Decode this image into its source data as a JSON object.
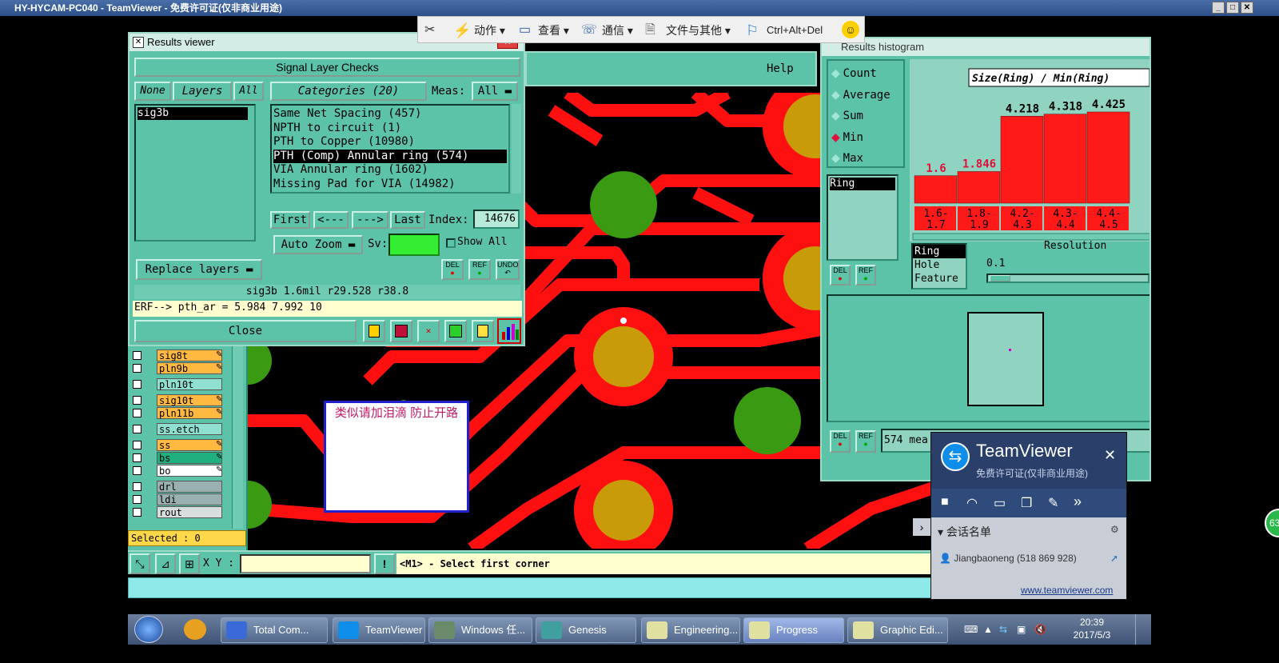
{
  "window": {
    "title": "HY-HYCAM-PC040 - TeamViewer - 免费许可证(仅非商业用途)"
  },
  "teamviewer_toolbar": {
    "actions": "动作",
    "view": "查看",
    "communicate": "通信",
    "files": "文件与其他",
    "cad": "Ctrl+Alt+Del"
  },
  "results_viewer": {
    "title": "Results viewer",
    "header": "Signal Layer Checks",
    "none_btn": "None",
    "layers_btn": "Layers",
    "all_btn": "All",
    "layer_items": [
      "sig3b"
    ],
    "categories_btn": "Categories (20)",
    "meas_label": "Meas:",
    "meas_value": "All",
    "categories": [
      "Same Net Spacing (457)",
      "NPTH to circuit (1)",
      "PTH to Copper (10980)",
      "PTH (Comp) Annular ring (574)",
      "VIA Annular ring (1602)",
      "Missing Pad for VIA (14982)"
    ],
    "first": "First",
    "prev": "<---",
    "next": "--->",
    "last": "Last",
    "index_label": "Index:",
    "index_value": "14676",
    "auto_zoom": "Auto Zoom",
    "sv_label": "Sv:",
    "show_all": "Show All",
    "replace_layers": "Replace layers",
    "del": "DEL",
    "ref": "REF",
    "undo": "UNDO",
    "status": "sig3b 1.6mil   r29.528  r38.8",
    "erf": "ERF--> pth_ar = 5.984 7.992 10",
    "close": "Close"
  },
  "results_histogram": {
    "title": "Results histogram",
    "help": "Help",
    "options": [
      "Count",
      "Average",
      "Sum",
      "Min",
      "Max"
    ],
    "selected_option": "Min",
    "chart_title": "Size(Ring) / Min(Ring)",
    "list_items": [
      "Ring"
    ],
    "type_items": [
      "Ring",
      "Hole",
      "Feature"
    ],
    "resolution_label": "Resolution",
    "resolution_value": "0.1",
    "del": "DEL",
    "ref": "REF",
    "measures_text": "574 mea",
    "bar_color": "#ff1a1a"
  },
  "chart_data": {
    "type": "bar",
    "title": "Size(Ring) / Min(Ring)",
    "categories": [
      "1.6-\n1.7",
      "1.8-\n1.9",
      "4.2-\n4.3",
      "4.3-\n4.4",
      "4.4-\n4.5"
    ],
    "category_labels": [
      [
        "1.6-",
        "1.7"
      ],
      [
        "1.8-",
        "1.9"
      ],
      [
        "4.2-",
        "4.3"
      ],
      [
        "4.3-",
        "4.4"
      ],
      [
        "4.4-",
        "4.5"
      ]
    ],
    "values": [
      1.6,
      1.846,
      4.218,
      4.318,
      4.425
    ],
    "value_labels": [
      "1.6",
      "1.846",
      "4.218",
      "4.318",
      "4.425"
    ],
    "ylim": [
      0,
      4.6
    ]
  },
  "layers_panel": {
    "layers": [
      {
        "name": "sig8t",
        "style": "orange",
        "marked": true
      },
      {
        "name": "pln9b",
        "style": "orange",
        "marked": true
      },
      {
        "name": "pln10t",
        "style": "teal",
        "marked": false
      },
      {
        "name": "sig10t",
        "style": "orange",
        "marked": true
      },
      {
        "name": "pln11b",
        "style": "orange",
        "marked": true
      },
      {
        "name": "ss.etch",
        "style": "teal",
        "marked": false
      },
      {
        "name": "ss",
        "style": "orange",
        "marked": true
      },
      {
        "name": "bs",
        "style": "green",
        "marked": true
      },
      {
        "name": "bo",
        "style": "white",
        "marked": true
      },
      {
        "name": "drl",
        "style": "gray",
        "marked": false
      },
      {
        "name": "ldi",
        "style": "gray",
        "marked": false
      },
      {
        "name": "rout",
        "style": "light",
        "marked": false
      }
    ],
    "selected": "Selected : 0"
  },
  "annotation_note": "类似请加泪滴  防止开路",
  "bottom_bar": {
    "xy_label": "X Y :",
    "xy_value": "",
    "prompt": "<M1> - Select first corner"
  },
  "tv_popup": {
    "brand": "TeamViewer",
    "license": "免费许可证(仅非商业用途)",
    "session_list": "会话名单",
    "contact": "Jiangbaoneng (518 869 928)",
    "link": "www.teamviewer.com"
  },
  "taskbar": {
    "apps": [
      "Total Com...",
      "TeamViewer",
      "Windows 任...",
      "Genesis",
      "Engineering...",
      "Progress",
      "Graphic Edi..."
    ],
    "time": "20:39",
    "date": "2017/5/3"
  },
  "side_badge": "63",
  "colors": {
    "teal": "#5dc3a8",
    "trace_red": "#ff1010",
    "pad_gold": "#c89b0a",
    "pad_green": "#3a9a12"
  }
}
